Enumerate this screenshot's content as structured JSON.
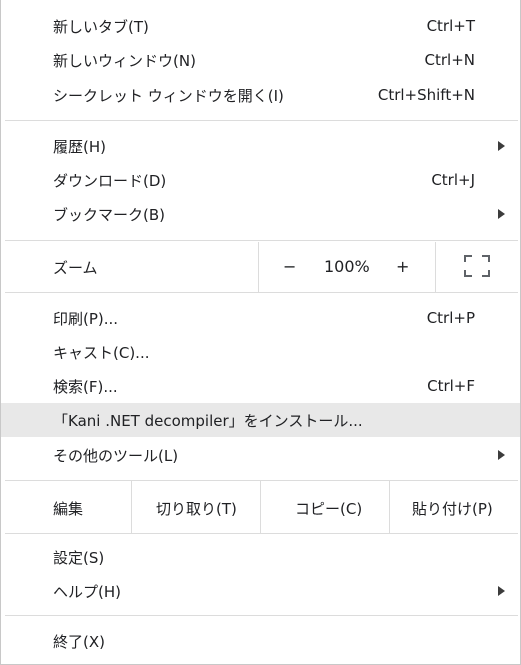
{
  "menu": {
    "new_tab": {
      "label": "新しいタブ(T)",
      "shortcut": "Ctrl+T"
    },
    "new_window": {
      "label": "新しいウィンドウ(N)",
      "shortcut": "Ctrl+N"
    },
    "incognito": {
      "label": "シークレット ウィンドウを開く(I)",
      "shortcut": "Ctrl+Shift+N"
    },
    "history": {
      "label": "履歴(H)"
    },
    "downloads": {
      "label": "ダウンロード(D)",
      "shortcut": "Ctrl+J"
    },
    "bookmarks": {
      "label": "ブックマーク(B)"
    },
    "zoom": {
      "label": "ズーム",
      "minus": "−",
      "level": "100%",
      "plus": "+"
    },
    "print": {
      "label": "印刷(P)...",
      "shortcut": "Ctrl+P"
    },
    "cast": {
      "label": "キャスト(C)..."
    },
    "find": {
      "label": "検索(F)...",
      "shortcut": "Ctrl+F"
    },
    "install": {
      "label": "「Kani .NET decompiler」をインストール..."
    },
    "more_tools": {
      "label": "その他のツール(L)"
    },
    "edit": {
      "label": "編集",
      "cut": "切り取り(T)",
      "copy": "コピー(C)",
      "paste": "貼り付け(P)"
    },
    "settings": {
      "label": "設定(S)"
    },
    "help": {
      "label": "ヘルプ(H)"
    },
    "exit": {
      "label": "終了(X)"
    }
  }
}
